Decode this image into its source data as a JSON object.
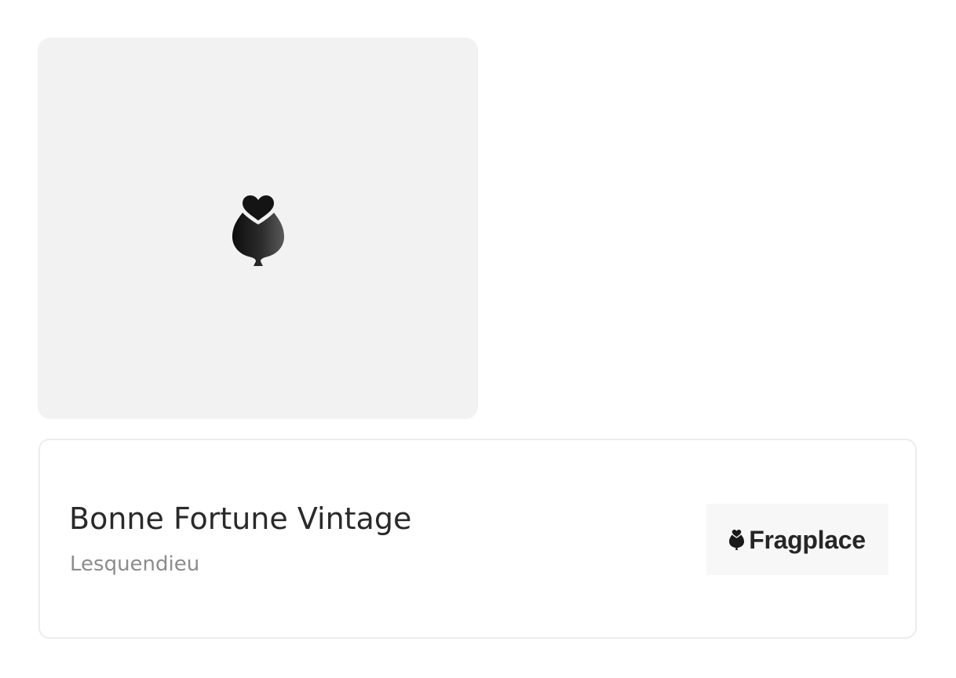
{
  "product": {
    "image_icon": "heart-bottle-icon",
    "title": "Bonne Fortune Vintage",
    "brand": "Lesquendieu"
  },
  "store_logo": {
    "icon": "heart-bottle-icon",
    "text": "Fragplace"
  },
  "colors": {
    "image_background": "#f2f2f2",
    "title_text": "#2a2a2a",
    "brand_text": "#8c8c8c",
    "card_border": "#ececec",
    "logo_background": "#f7f7f7"
  }
}
